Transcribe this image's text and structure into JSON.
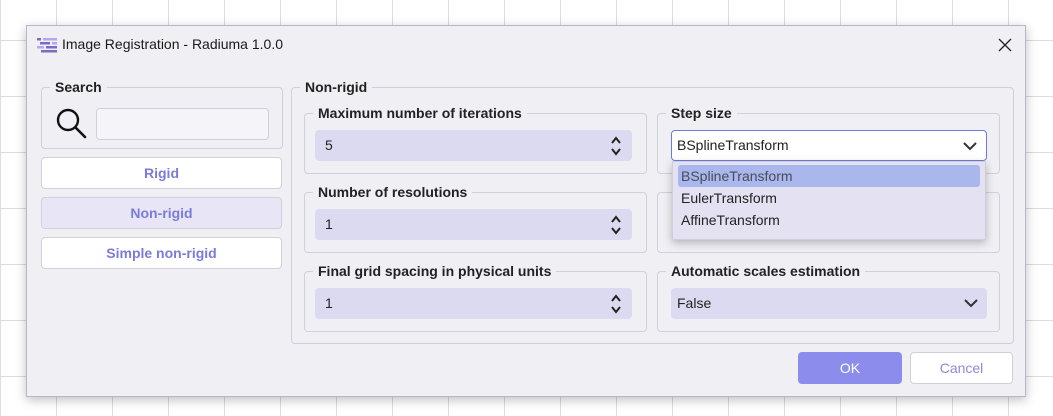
{
  "window": {
    "title": "Image Registration - Radiuma 1.0.0",
    "icons": {
      "app": "radiuma-app-icon",
      "close": "close-icon"
    }
  },
  "sidebar": {
    "search": {
      "title": "Search",
      "placeholder": "",
      "value": "",
      "icon": "search-icon"
    },
    "nav": [
      {
        "label": "Rigid",
        "active": false
      },
      {
        "label": "Non-rigid",
        "active": true
      },
      {
        "label": "Simple non-rigid",
        "active": false
      }
    ]
  },
  "panel": {
    "title": "Non-rigid",
    "fields": {
      "max_iterations": {
        "label": "Maximum number of iterations",
        "value": "5"
      },
      "step_size": {
        "label": "Step size",
        "value": "BSplineTransform",
        "options": [
          "BSplineTransform",
          "EulerTransform",
          "AffineTransform"
        ],
        "selected_index": 0
      },
      "resolutions": {
        "label": "Number of resolutions",
        "value": "1"
      },
      "grid_spacing": {
        "label": "Final grid spacing in physical units",
        "value": "1"
      },
      "auto_scales": {
        "label": "Automatic scales estimation",
        "value": "False"
      }
    }
  },
  "buttons": {
    "ok": "OK",
    "cancel": "Cancel"
  },
  "colors": {
    "accent": "#8c8cec",
    "nav_text": "#7b7bd9",
    "field_bg": "#dcdaf0",
    "dropdown_highlight": "#a9b7ec",
    "dialog_bg": "#f0f0f4"
  }
}
